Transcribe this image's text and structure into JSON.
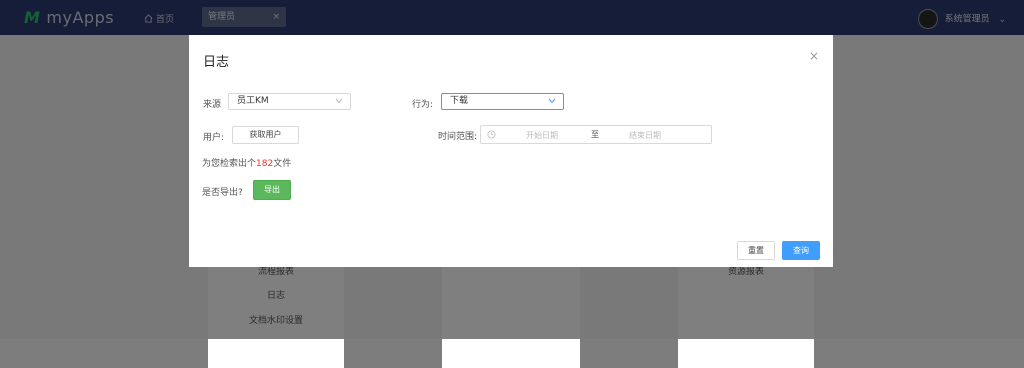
{
  "topbar": {
    "brand": "myApps",
    "home_label": "首页",
    "open_tab": "管理员",
    "open_tab_close": "×",
    "user_name": "系统管理员"
  },
  "background": {
    "card_items": [
      "流程报表",
      "日志",
      "文档水印设置"
    ],
    "card3_item": "资源报表"
  },
  "dialog": {
    "title": "日志",
    "close": "×",
    "source_label": "来源",
    "source_value": "员工KM",
    "action_label": "行为:",
    "action_value": "下载",
    "user_label": "用户:",
    "get_user_button": "获取用户",
    "time_range_label": "时间范围:",
    "start_placeholder": "开始日期",
    "range_separator": "至",
    "end_placeholder": "结束日期",
    "result_prefix": "为您检索出个",
    "result_count": "182",
    "result_suffix": "文件",
    "export_question": "是否导出?",
    "export_button": "导出",
    "reset_button": "重置",
    "search_button": "查询"
  },
  "colors": {
    "topbar": "#2d3a73",
    "primary": "#409eff",
    "export_green": "#5cb85c",
    "count_red": "#ff2b2b"
  },
  "icons": {
    "brand": "m-logo-icon",
    "home": "home-icon",
    "close": "close-icon",
    "chevron": "chevron-down-icon",
    "clock": "clock-icon"
  }
}
